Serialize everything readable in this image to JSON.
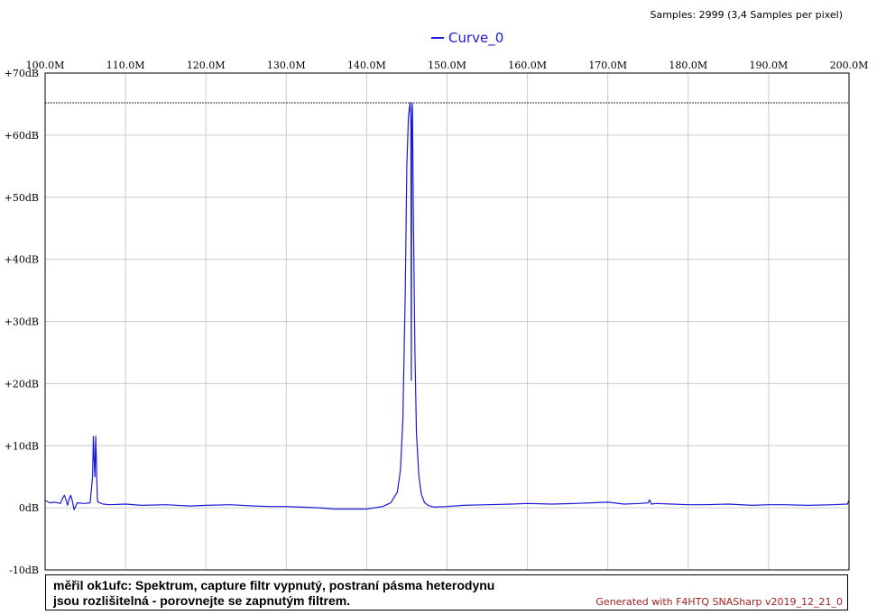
{
  "header": {
    "samples_text": "Samples: 2999 (3,4 Samples per pixel)"
  },
  "legend": {
    "label": "Curve_0",
    "color": "#1a1ad6"
  },
  "comment": {
    "text": "měřil ok1ufc: Spektrum, capture filtr vypnutý, postraní pásma heterodynu\njsou rozlišitelná - porovnejte se zapnutým filtrem."
  },
  "footer": {
    "generated_text": "Generated with F4HTQ SNASharp v2019_12_21_0"
  },
  "chart_data": {
    "type": "line",
    "title": "",
    "xlabel": "",
    "ylabel": "",
    "xlim": [
      100,
      200
    ],
    "ylim": [
      -10,
      70
    ],
    "x_unit": "MHz",
    "y_unit": "dB",
    "grid": true,
    "legend_position": "top-center",
    "x_ticks": [
      "100.0M",
      "110.0M",
      "120.0M",
      "130.0M",
      "140.0M",
      "150.0M",
      "160.0M",
      "170.0M",
      "180.0M",
      "190.0M",
      "200.0M"
    ],
    "x_tick_values": [
      100,
      110,
      120,
      130,
      140,
      150,
      160,
      170,
      180,
      190,
      200
    ],
    "y_ticks": [
      "+70dB",
      "+60dB",
      "+50dB",
      "+40dB",
      "+30dB",
      "+20dB",
      "+10dB",
      "0dB",
      "-10dB"
    ],
    "y_tick_values": [
      70,
      60,
      50,
      40,
      30,
      20,
      10,
      0,
      -10
    ],
    "marker_line_db": 65.2,
    "series": [
      {
        "name": "Curve_0",
        "color": "#1a1ad6",
        "x": [
          100.0,
          100.6,
          101.2,
          101.9,
          102.2,
          102.4,
          102.6,
          102.8,
          103.0,
          103.2,
          103.4,
          103.6,
          104.0,
          104.8,
          105.6,
          105.9,
          106.0,
          106.1,
          106.2,
          106.25,
          106.3,
          106.4,
          106.5,
          106.6,
          106.8,
          107.2,
          108.0,
          110.0,
          112.0,
          115.0,
          118.0,
          120.0,
          123.0,
          126.0,
          128.0,
          130.0,
          132.0,
          134.0,
          136.0,
          138.0,
          140.0,
          142.0,
          143.0,
          143.8,
          144.2,
          144.5,
          144.8,
          145.0,
          145.2,
          145.4,
          145.5,
          145.55,
          145.6,
          145.65,
          145.7,
          145.8,
          146.0,
          146.2,
          146.5,
          146.8,
          147.2,
          147.8,
          148.5,
          150.0,
          152.0,
          155.0,
          158.0,
          160.0,
          163.0,
          166.0,
          168.0,
          170.0,
          172.0,
          174.0,
          175.0,
          175.2,
          175.4,
          176.0,
          178.0,
          180.0,
          182.0,
          185.0,
          188.0,
          190.0,
          192.0,
          195.0,
          198.0,
          199.8,
          200.0
        ],
        "y": [
          1.2,
          0.8,
          0.9,
          0.7,
          1.6,
          2.0,
          1.3,
          0.4,
          1.5,
          2.0,
          1.0,
          -0.3,
          0.8,
          0.7,
          0.8,
          5.0,
          11.5,
          7.5,
          5.0,
          9.0,
          11.5,
          6.5,
          1.3,
          0.9,
          0.8,
          0.6,
          0.5,
          0.6,
          0.4,
          0.5,
          0.3,
          0.4,
          0.5,
          0.3,
          0.2,
          0.2,
          0.1,
          0.0,
          -0.2,
          -0.2,
          -0.2,
          0.2,
          0.8,
          2.5,
          6.0,
          14.0,
          35.0,
          55.0,
          63.0,
          65.2,
          62.0,
          20.5,
          58.0,
          65.2,
          64.0,
          48.0,
          25.0,
          12.0,
          5.0,
          2.2,
          0.8,
          0.3,
          0.1,
          0.2,
          0.4,
          0.5,
          0.6,
          0.7,
          0.6,
          0.7,
          0.8,
          0.9,
          0.6,
          0.7,
          0.8,
          1.3,
          0.6,
          0.7,
          0.6,
          0.5,
          0.5,
          0.6,
          0.4,
          0.5,
          0.5,
          0.4,
          0.5,
          0.6,
          1.2
        ]
      }
    ]
  }
}
